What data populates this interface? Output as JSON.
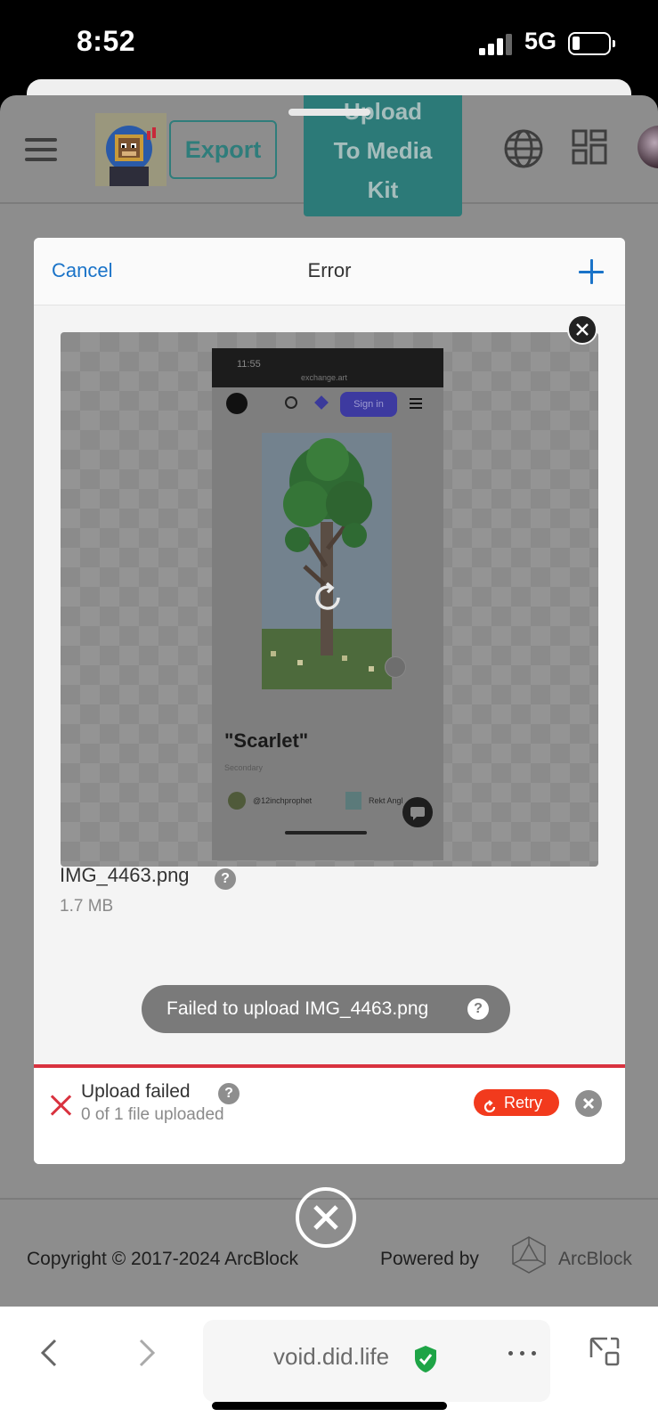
{
  "status_bar": {
    "time": "8:52",
    "network": "5G"
  },
  "header": {
    "export_label": "Export",
    "upload_label_lines": [
      "Upload",
      "To Media",
      "Kit"
    ]
  },
  "dialog": {
    "cancel_label": "Cancel",
    "title": "Error",
    "preview": {
      "screenshot_time": "11:55",
      "screenshot_url": "exchange.art",
      "sign_in_label": "Sign in",
      "artwork_title": "\"Scarlet\"",
      "artwork_subtitle": "Secondary",
      "creator": "@12inchprophet",
      "owner": "Rekt Angl"
    },
    "file": {
      "name": "IMG_4463.png",
      "size": "1.7 MB",
      "help_glyph": "?"
    },
    "toast": {
      "text": "Failed to upload IMG_4463.png",
      "help_glyph": "?"
    },
    "status": {
      "title": "Upload failed",
      "count": "0 of 1 file uploaded",
      "retry_label": "Retry",
      "help_glyph": "?"
    }
  },
  "footer": {
    "copyright": "Copyright © 2017-2024   ArcBlock",
    "powered_by": "Powered by",
    "brand": "ArcBlock"
  },
  "browser": {
    "url": "void.did.life"
  },
  "colors": {
    "accent_teal": "#2c7a78",
    "link_blue": "#1a73c8",
    "error_red": "#d9323f",
    "retry_orange": "#f23a1d",
    "secure_green": "#1ea446"
  },
  "icons": [
    "menu-icon",
    "globe-icon",
    "grid-icon",
    "plus-icon",
    "close-icon",
    "refresh-icon",
    "help-icon",
    "x-icon",
    "retry-icon",
    "back-icon",
    "forward-icon",
    "shield-check-icon",
    "more-icon",
    "tabs-icon",
    "arcblock-logo"
  ]
}
